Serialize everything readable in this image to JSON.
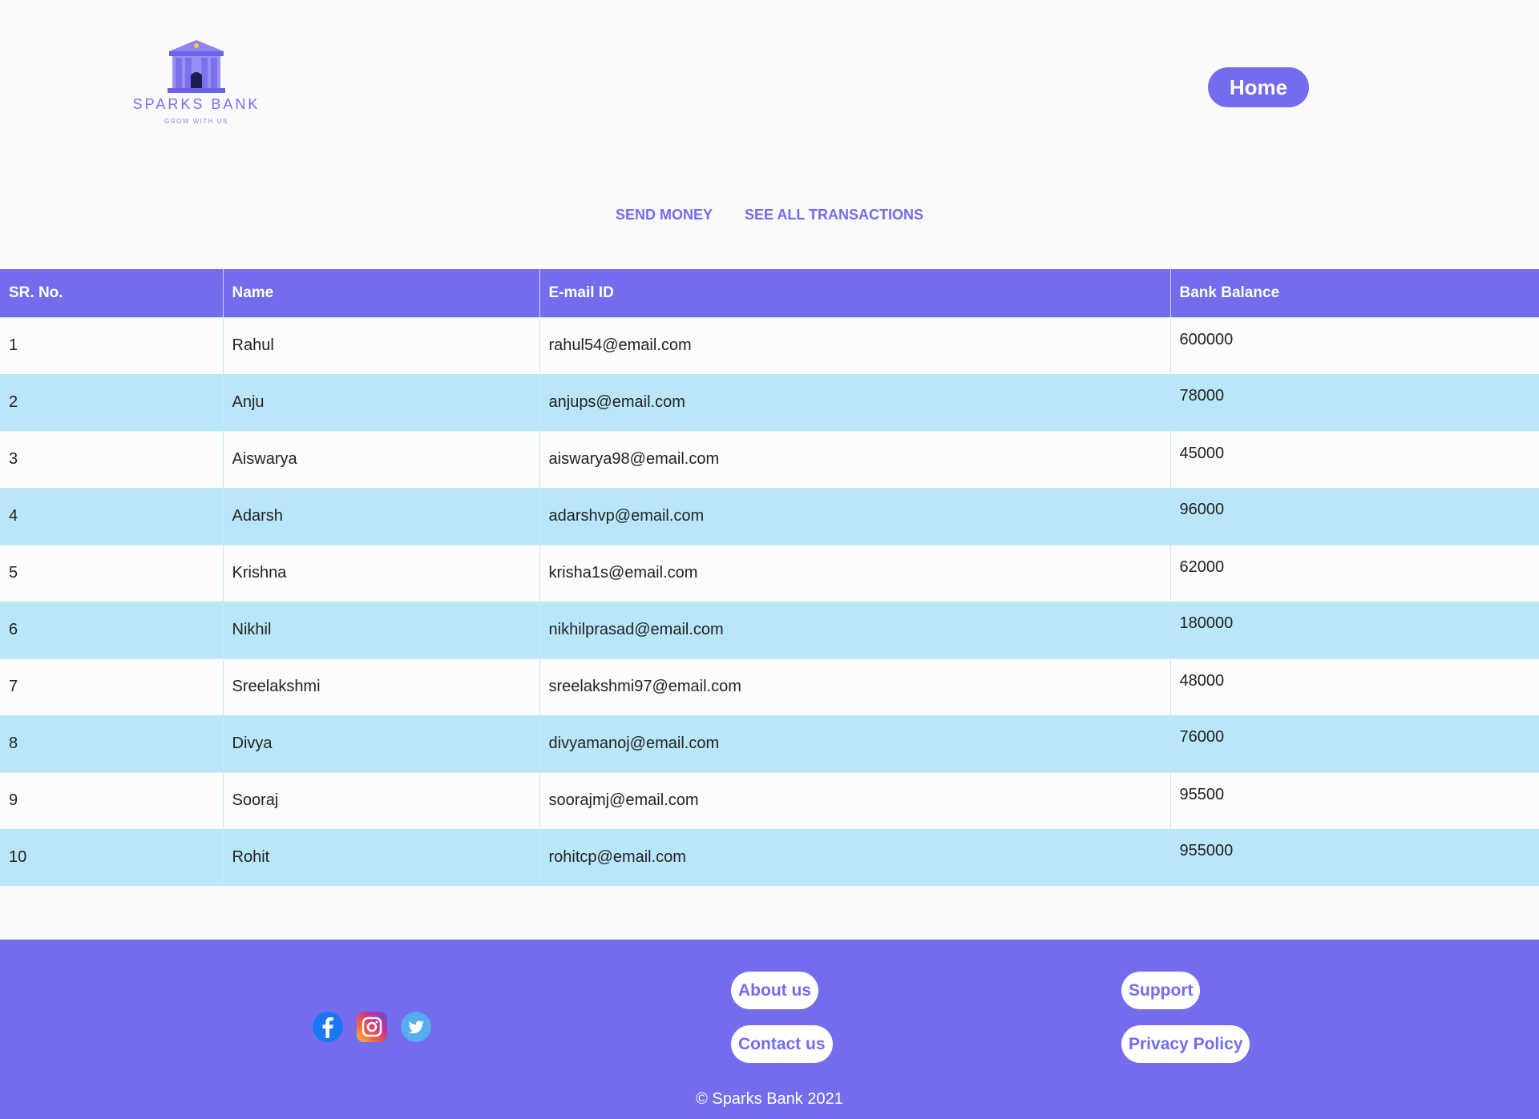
{
  "brand": {
    "name": "SPARKS BANK",
    "tagline": "GROW WITH US"
  },
  "header": {
    "home_label": "Home"
  },
  "nav": {
    "send_money": "SEND MONEY",
    "see_all": "SEE ALL TRANSACTIONS"
  },
  "table": {
    "headers": [
      "SR. No.",
      "Name",
      "E-mail ID",
      "Bank Balance"
    ],
    "rows": [
      [
        "1",
        "Rahul",
        "rahul54@email.com",
        "600000"
      ],
      [
        "2",
        "Anju",
        "anjups@email.com",
        "78000"
      ],
      [
        "3",
        "Aiswarya",
        "aiswarya98@email.com",
        "45000"
      ],
      [
        "4",
        "Adarsh",
        "adarshvp@email.com",
        "96000"
      ],
      [
        "5",
        "Krishna",
        "krisha1s@email.com",
        "62000"
      ],
      [
        "6",
        "Nikhil",
        "nikhilprasad@email.com",
        "180000"
      ],
      [
        "7",
        "Sreelakshmi",
        "sreelakshmi97@email.com",
        "48000"
      ],
      [
        "8",
        "Divya",
        "divyamanoj@email.com",
        "76000"
      ],
      [
        "9",
        "Sooraj",
        "soorajmj@email.com",
        "95500"
      ],
      [
        "10",
        "Rohit",
        "rohitcp@email.com",
        "955000"
      ]
    ]
  },
  "footer": {
    "social": [
      "facebook-icon",
      "instagram-icon",
      "twitter-icon"
    ],
    "about": "About us",
    "contact": "Contact us",
    "support": "Support",
    "privacy": "Privacy Policy",
    "copyright": "© Sparks Bank 2021"
  },
  "colors": {
    "accent": "#736ced",
    "row_alt": "#b9e7f9",
    "background": "#fafafa"
  }
}
